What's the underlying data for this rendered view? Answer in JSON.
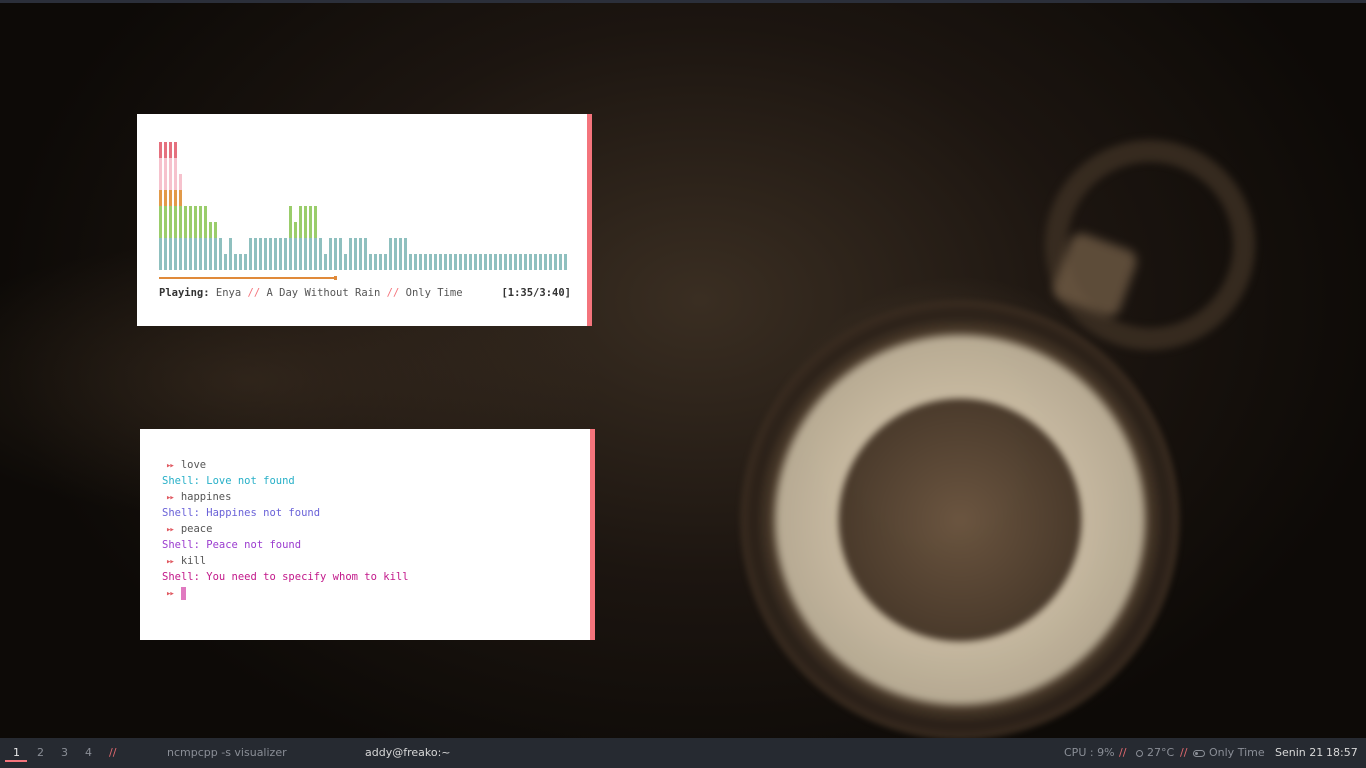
{
  "visualizer": {
    "levels": [
      8,
      8,
      8,
      8,
      6,
      4,
      4,
      4,
      4,
      4,
      3,
      3,
      2,
      1,
      2,
      1,
      1,
      1,
      2,
      2,
      2,
      2,
      2,
      2,
      2,
      2,
      4,
      3,
      4,
      4,
      4,
      4,
      2,
      1,
      2,
      2,
      2,
      1,
      2,
      2,
      2,
      2,
      1,
      1,
      1,
      1,
      2,
      2,
      2,
      2,
      1,
      1,
      1,
      1,
      1,
      1,
      1,
      1,
      1,
      1,
      1,
      1,
      1,
      1,
      1,
      1,
      1,
      1,
      1,
      1,
      1,
      1,
      1,
      1,
      1,
      1,
      1,
      1,
      1,
      1,
      1,
      1
    ],
    "colors": {
      "base": "#8fc0bf",
      "green": "#9acd6b",
      "orange": "#e29a49",
      "pink": "#f6c2cd",
      "red": "#e5707e"
    },
    "progress": 0.43,
    "now_playing_label": "Playing:",
    "artist": "Enya",
    "separator": "//",
    "album": "A Day Without Rain",
    "title": "Only Time",
    "time": "[1:35/3:40]"
  },
  "terminal": {
    "prompt_icon": "▸▸",
    "lines": [
      {
        "type": "cmd",
        "text": "love"
      },
      {
        "type": "out",
        "text": "Shell: Love not found",
        "color": "#28b0c8"
      },
      {
        "type": "cmd",
        "text": "happines"
      },
      {
        "type": "out",
        "text": "Shell: Happines not found",
        "color": "#6a62d8"
      },
      {
        "type": "cmd",
        "text": "peace"
      },
      {
        "type": "out",
        "text": "Shell: Peace not found",
        "color": "#9b3ccf"
      },
      {
        "type": "cmd",
        "text": "kill"
      },
      {
        "type": "out",
        "text": "Shell: You need to specify whom to kill",
        "color": "#c2188a"
      },
      {
        "type": "prompt",
        "text": ""
      }
    ]
  },
  "panel": {
    "workspaces": [
      "1",
      "2",
      "3",
      "4"
    ],
    "active_workspace": "1",
    "separator": "//",
    "window_title": "ncmpcpp -s visualizer",
    "user_host": "addy@freako:~",
    "cpu": "CPU : 9%",
    "temp": "27°C",
    "song": "Only Time",
    "day": "Senin 21",
    "time": "18:57"
  }
}
